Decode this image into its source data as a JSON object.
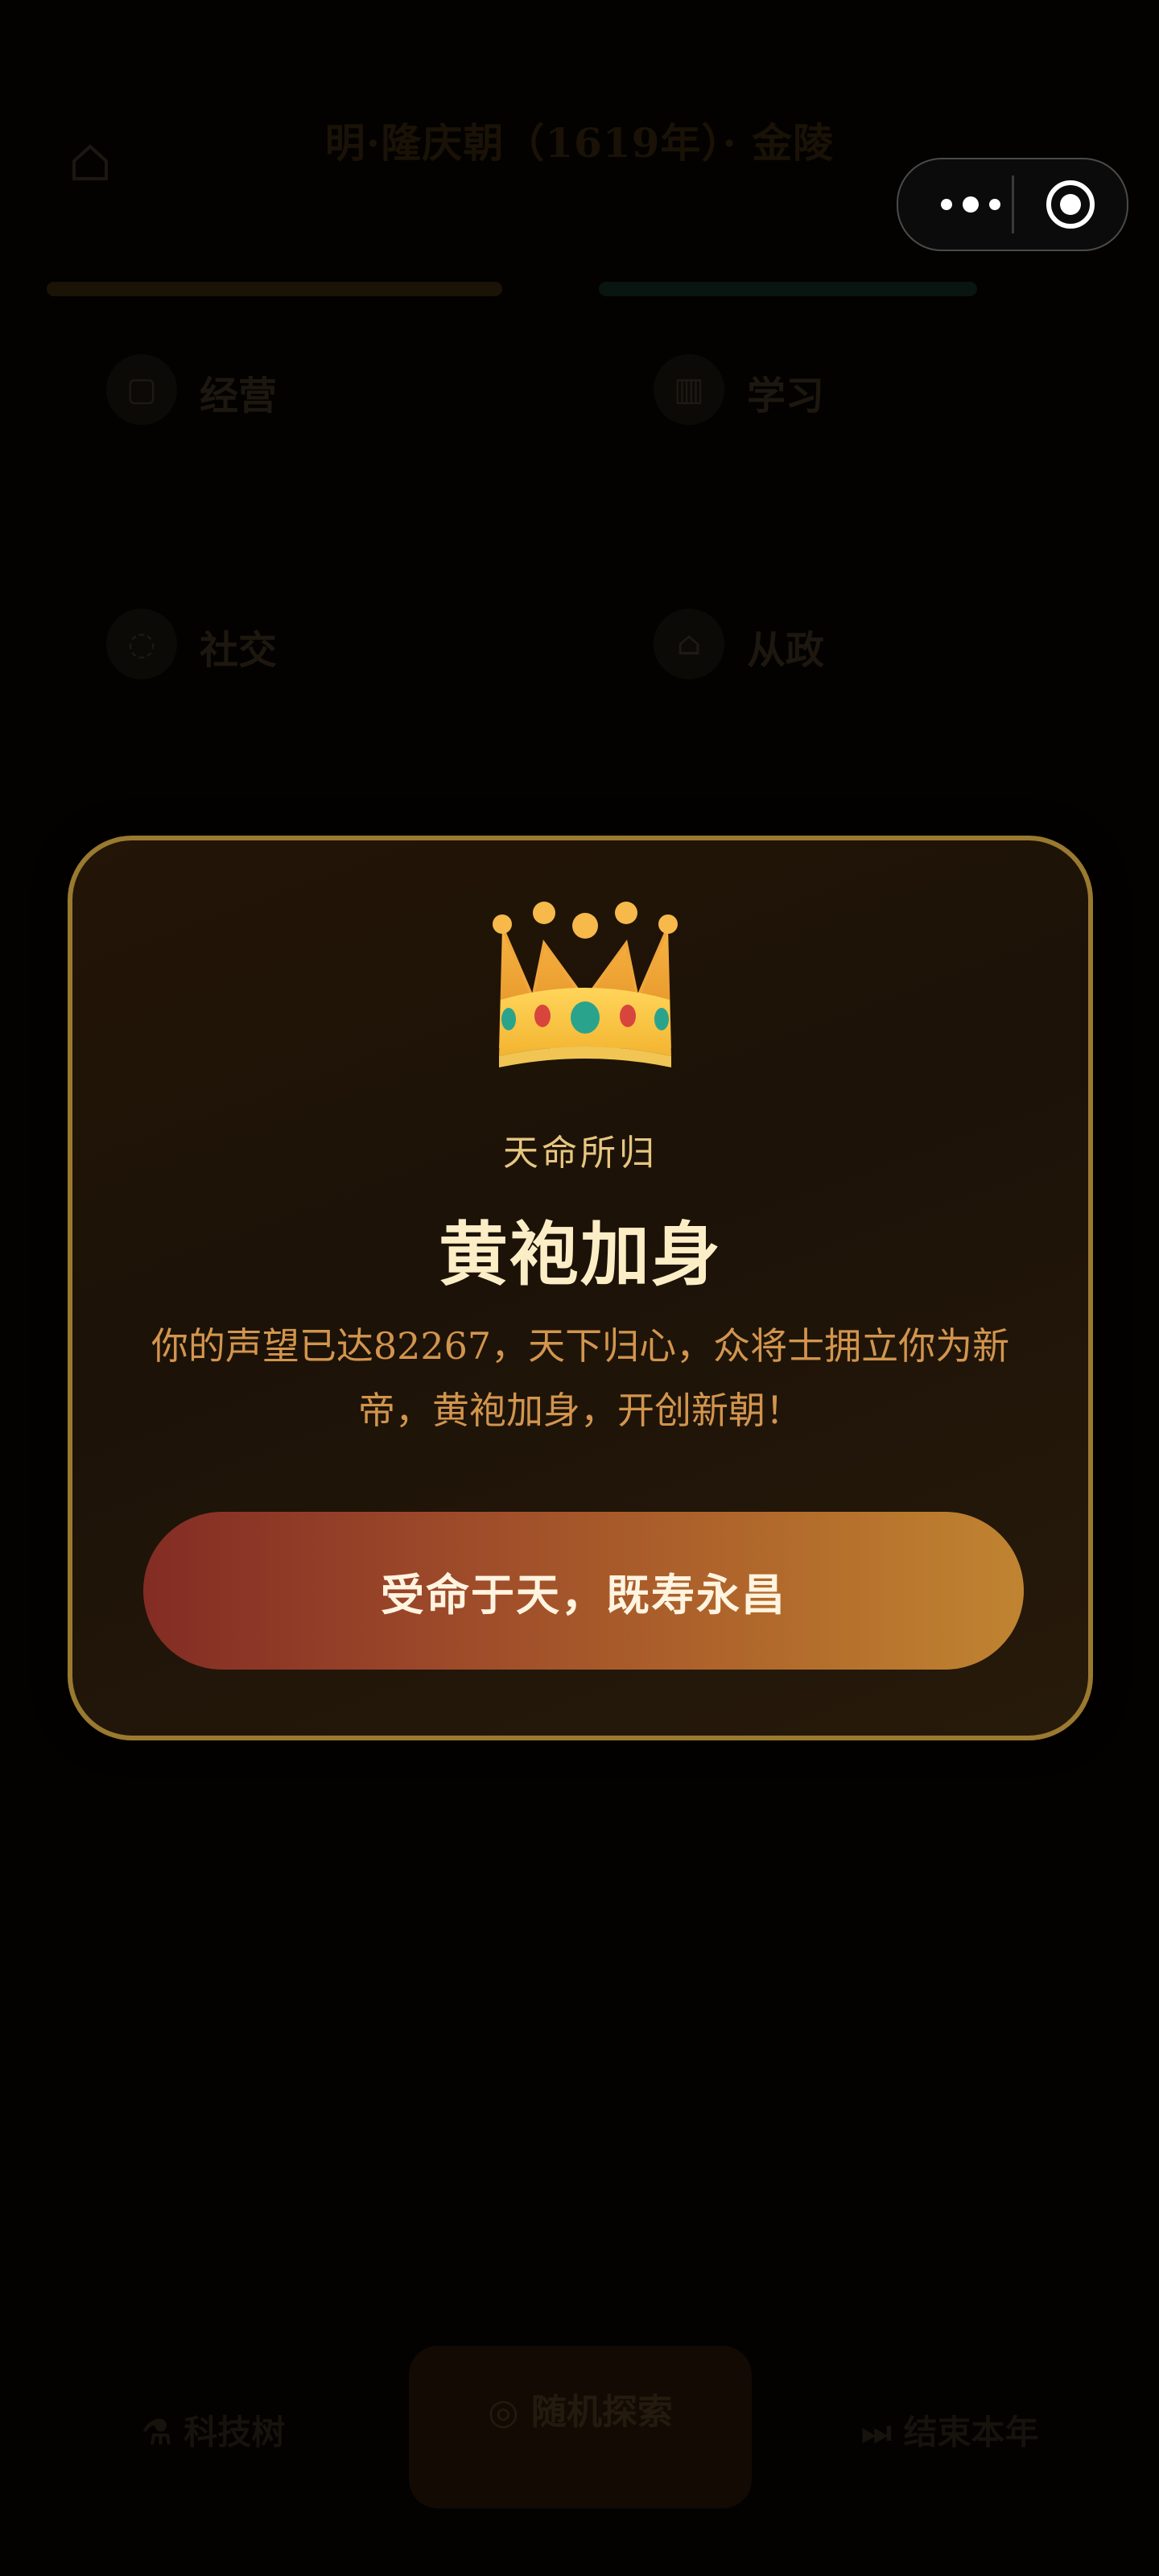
{
  "background": {
    "header": {
      "title": "明·隆庆朝（1619年）· 金陵",
      "subtitle": "",
      "home_icon": "home-icon"
    },
    "actions": [
      {
        "label": "经营",
        "icon": "shop-icon"
      },
      {
        "label": "学习",
        "icon": "book-icon"
      },
      {
        "label": "社交",
        "icon": "people-icon"
      },
      {
        "label": "从政",
        "icon": "government-icon"
      }
    ],
    "bottom_bar": {
      "left_label": "科技树",
      "center_label": "随机探索",
      "center_sub": "",
      "right_label": "结束本年"
    }
  },
  "capsule": {
    "more_icon": "more-dots-icon",
    "close_icon": "target-close-icon"
  },
  "modal": {
    "icon": "👑",
    "kicker": "天命所归",
    "title": "黄袍加身",
    "message": "你的声望已达82267，天下归心，众将士拥立你为新帝，黄袍加身，开创新朝！",
    "button_label": "受命于天，既寿永昌",
    "colors": {
      "border": "#9a7a2f",
      "title": "#fbeec7",
      "body": "#d2954e",
      "button_start": "#832c24",
      "button_end": "#c08431"
    }
  }
}
